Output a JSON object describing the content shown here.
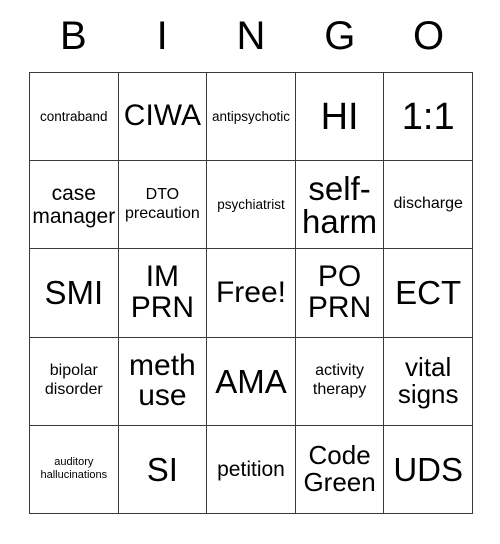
{
  "card": {
    "header_letters": [
      "B",
      "I",
      "N",
      "G",
      "O"
    ],
    "rows": [
      [
        {
          "text": "contraband",
          "size": "fs-s"
        },
        {
          "text": "CIWA",
          "size": "fs-2xl"
        },
        {
          "text": "antipsychotic",
          "size": "fs-s"
        },
        {
          "text": "HI",
          "size": "fs-4xl"
        },
        {
          "text": "1:1",
          "size": "fs-4xl"
        }
      ],
      [
        {
          "text": "case manager",
          "size": "fs-l"
        },
        {
          "text": "DTO precaution",
          "size": "fs-m"
        },
        {
          "text": "psychiatrist",
          "size": "fs-s"
        },
        {
          "text": "self-harm",
          "size": "fs-3xl"
        },
        {
          "text": "discharge",
          "size": "fs-m"
        }
      ],
      [
        {
          "text": "SMI",
          "size": "fs-3xl"
        },
        {
          "text": "IM PRN",
          "size": "fs-2xl"
        },
        {
          "text": "Free!",
          "size": "fs-2xl"
        },
        {
          "text": "PO PRN",
          "size": "fs-2xl"
        },
        {
          "text": "ECT",
          "size": "fs-3xl"
        }
      ],
      [
        {
          "text": "bipolar disorder",
          "size": "fs-m"
        },
        {
          "text": "meth use",
          "size": "fs-2xl"
        },
        {
          "text": "AMA",
          "size": "fs-3xl"
        },
        {
          "text": "activity therapy",
          "size": "fs-m"
        },
        {
          "text": "vital signs",
          "size": "fs-xl"
        }
      ],
      [
        {
          "text": "auditory hallucinations",
          "size": "fs-xs"
        },
        {
          "text": "SI",
          "size": "fs-3xl"
        },
        {
          "text": "petition",
          "size": "fs-l"
        },
        {
          "text": "Code Green",
          "size": "fs-xl"
        },
        {
          "text": "UDS",
          "size": "fs-3xl"
        }
      ]
    ]
  },
  "colors": {
    "border": "#3a3a3a",
    "text": "#000000",
    "background": "#ffffff"
  }
}
